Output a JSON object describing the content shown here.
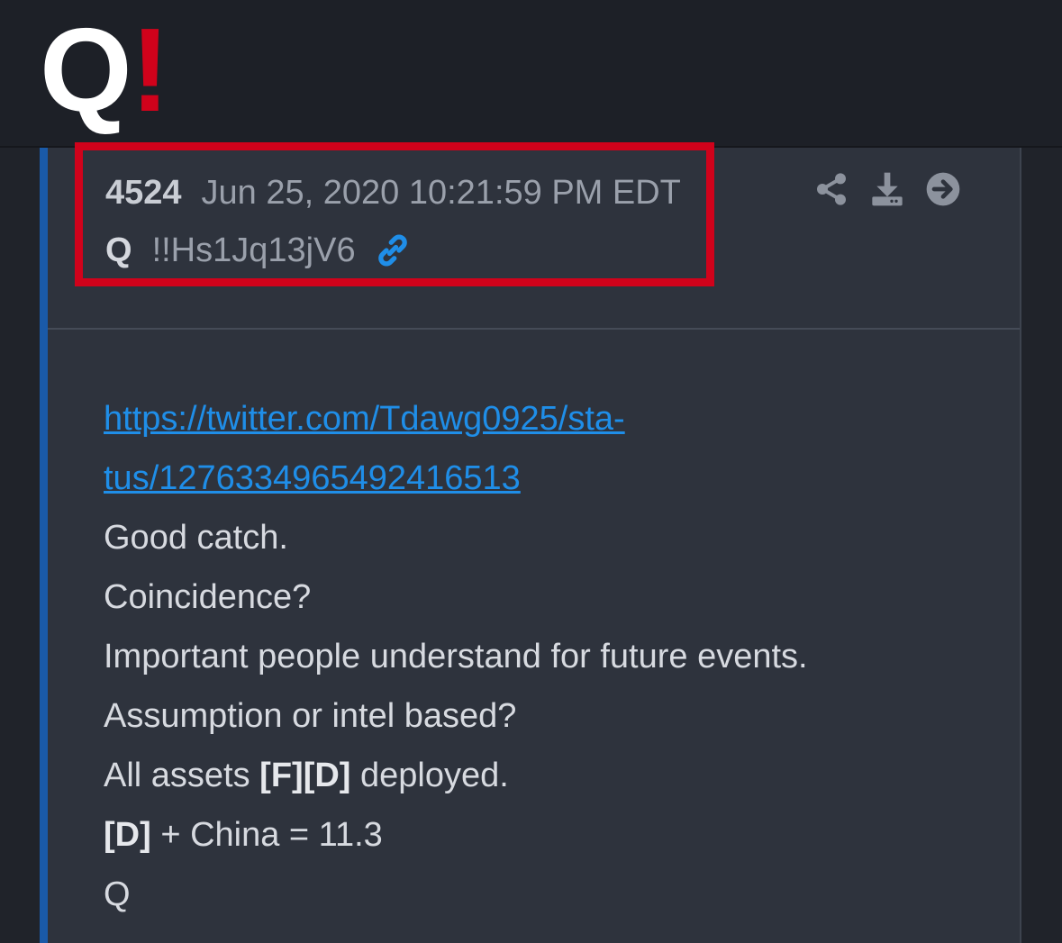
{
  "header": {
    "logo_q": "Q",
    "logo_bang": "!"
  },
  "post": {
    "number": "4524",
    "datetime": "Jun 25, 2020 10:21:59 PM EDT",
    "author": "Q",
    "tripcode": "!!Hs1Jq13jV6",
    "link_icon": "link-icon",
    "actions": [
      "share-icon",
      "download-icon",
      "arrow-right-icon"
    ],
    "url_line1": "https://twitter.com/Tdawg0925/sta-",
    "url_line2": "tus/1276334965492416513",
    "lines": [
      "Good catch.",
      "Coincidence?",
      "Important people understand for future events.",
      "Assumption or intel based?"
    ],
    "assets_prefix": "All assets ",
    "assets_bold": "[F][D]",
    "assets_suffix": " deployed.",
    "china_bold": "[D]",
    "china_suffix": " + China = 11.3",
    "signature": "Q"
  },
  "colors": {
    "accent_red": "#d0021b",
    "link_blue": "#1f8ee8",
    "post_border": "#1a5aa8"
  }
}
